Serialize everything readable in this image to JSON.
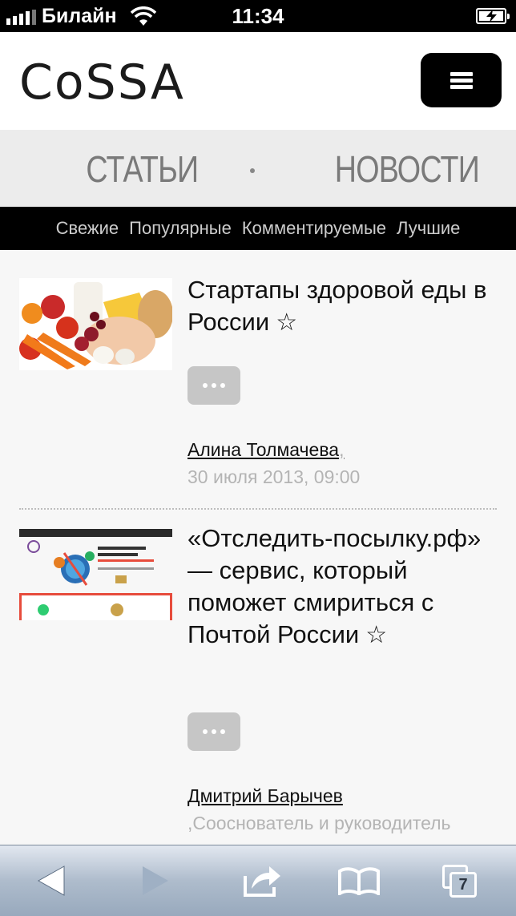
{
  "status_bar": {
    "carrier": "Билайн",
    "time": "11:34"
  },
  "header": {
    "logo": "CoSSA"
  },
  "sections": {
    "items": [
      "СТАТЬИ",
      "НОВОСТИ"
    ]
  },
  "subnav": {
    "items": [
      "Свежие",
      "Популярные",
      "Комментируемые",
      "Лучшие"
    ]
  },
  "articles": [
    {
      "title": "Стартапы здоровой еды в России",
      "star": "☆",
      "author": "Алина Толмачева",
      "author_suffix": ",",
      "date": "30 июля 2013, 09:00"
    },
    {
      "title": "«Отследить-посылку.рф» — сервис, который поможет смириться с Почтой России",
      "star": "☆",
      "author": "Дмитрий Барычев",
      "role": ",Сооснователь и руководитель"
    }
  ],
  "toolbar": {
    "tabs_count": "7"
  },
  "colors": {
    "page_bg": "#f7f7f7",
    "nav_bg": "#ececec",
    "subnav_bg": "#000000",
    "button_grey": "#c6c6c6"
  }
}
